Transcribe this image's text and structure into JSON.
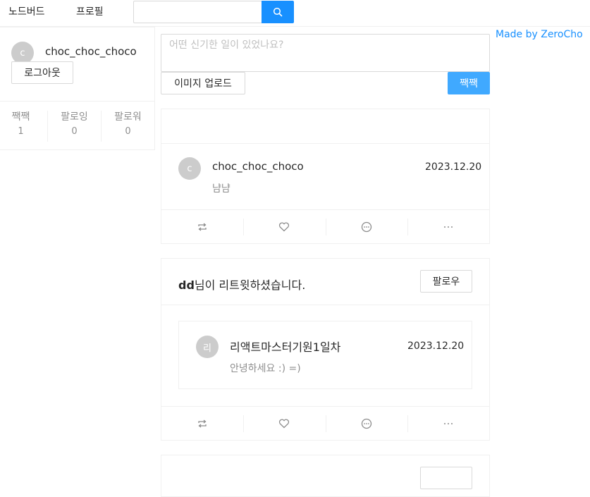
{
  "nav": {
    "brand": "노드버드",
    "profile": "프로필",
    "search_value": "",
    "search_icon": "search-icon"
  },
  "profile_card": {
    "avatar_letter": "c",
    "nickname": "choc_choc_choco",
    "logout_label": "로그아웃",
    "stats": [
      {
        "label": "짹짹",
        "value": "1"
      },
      {
        "label": "팔로잉",
        "value": "0"
      },
      {
        "label": "팔로워",
        "value": "0"
      }
    ]
  },
  "made_by": "Made by ZeroCho",
  "post_form": {
    "placeholder": "어떤 신기한 일이 있었나요?",
    "upload_label": "이미지 업로드",
    "submit_label": "짹짹"
  },
  "posts": [
    {
      "author_letter": "c",
      "author": "choc_choc_choco",
      "date": "2023.12.20",
      "content": "냠냠"
    },
    {
      "retweeter": "dd",
      "retweet_text": "님이 리트윗하셨습니다.",
      "follow_label": "팔로우",
      "author_letter": "리",
      "author": "리액트마스터기원1일차",
      "date": "2023.12.20",
      "content": "안녕하세요 :) =)"
    }
  ],
  "action_icons": [
    "retweet-icon",
    "heart-icon",
    "message-icon",
    "ellipsis-icon"
  ],
  "colors": {
    "primary": "#1890ff",
    "primary_light": "#40a9ff",
    "border": "#f0f0f0"
  }
}
